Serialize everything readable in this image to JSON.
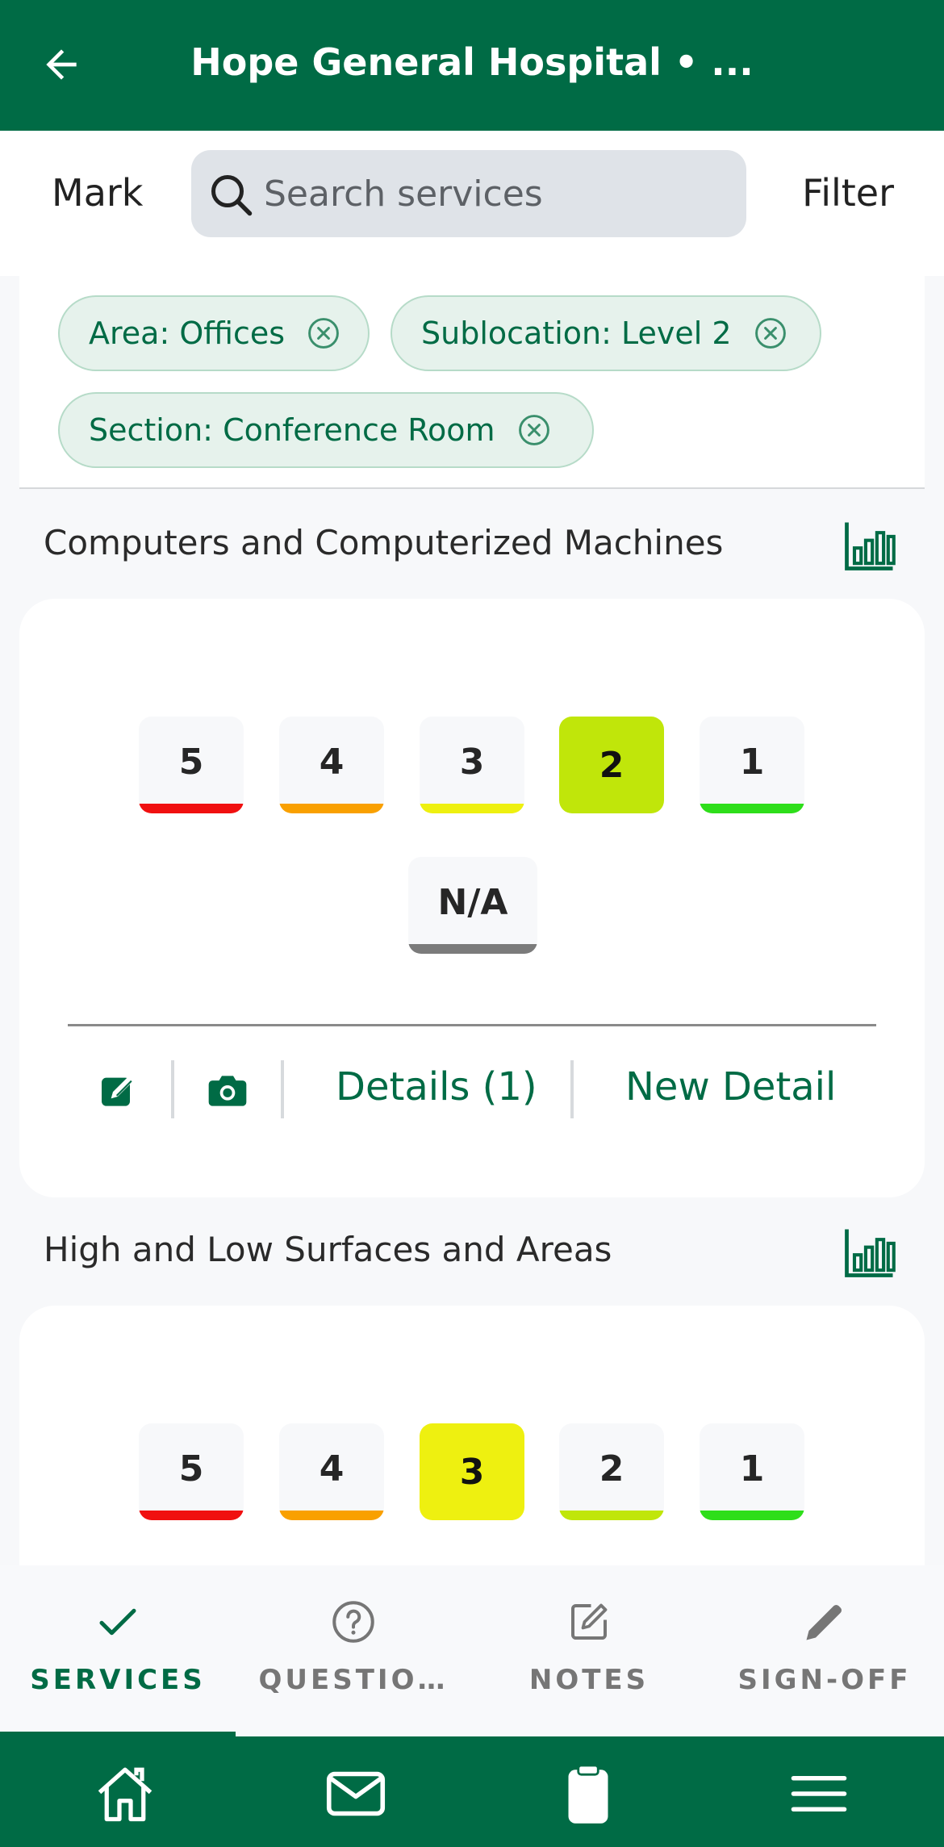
{
  "header": {
    "title": "Hope General Hospital • ...",
    "back_icon": "arrow-left-icon"
  },
  "toolbar": {
    "mark_label": "Mark",
    "search_placeholder": "Search services",
    "search_value": "",
    "filter_label": "Filter"
  },
  "filters": [
    {
      "label": "Area: Offices",
      "icon": "close-circle-icon"
    },
    {
      "label": "Sublocation: Level 2",
      "icon": "close-circle-icon"
    },
    {
      "label": "Section: Conference Room",
      "icon": "close-circle-icon"
    }
  ],
  "rating_colors": {
    "5": "#f01010",
    "4": "#f9a000",
    "3": "#eef010",
    "2": "#c0e60a",
    "1": "#2ede1a",
    "na": "#7b7b7b"
  },
  "services": [
    {
      "title": "Computers and Computerized Machines",
      "chart_icon": "bar-chart-icon",
      "ratings": [
        "5",
        "4",
        "3",
        "2",
        "1"
      ],
      "selected": "2",
      "na_label": "N/A",
      "actions": {
        "edit_icon": "edit-icon",
        "camera_icon": "camera-icon",
        "details_label": "Details (1)",
        "new_detail_label": "New Detail"
      }
    },
    {
      "title": "High and Low Surfaces and Areas",
      "chart_icon": "bar-chart-icon",
      "ratings": [
        "5",
        "4",
        "3",
        "2",
        "1"
      ],
      "selected": "3"
    }
  ],
  "bottom_tabs": [
    {
      "label": "SERVICES",
      "icon": "check-icon",
      "active": true
    },
    {
      "label": "QUESTIO…",
      "icon": "question-circle-icon",
      "active": false
    },
    {
      "label": "NOTES",
      "icon": "notes-icon",
      "active": false
    },
    {
      "label": "SIGN-OFF",
      "icon": "pencil-icon",
      "active": false
    }
  ],
  "bottom_nav": [
    {
      "icon": "home-icon"
    },
    {
      "icon": "mail-icon"
    },
    {
      "icon": "clipboard-icon"
    },
    {
      "icon": "menu-icon"
    }
  ]
}
